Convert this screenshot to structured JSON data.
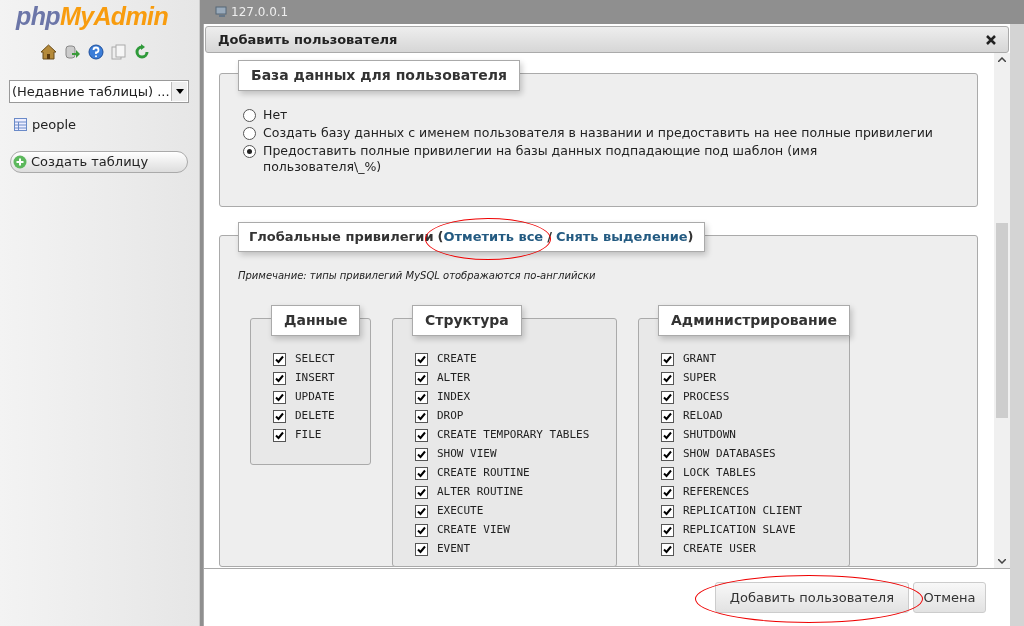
{
  "sidebar": {
    "logo": {
      "part1": "php",
      "part2": "MyAdmin"
    },
    "recent_tables": {
      "value": "(Недавние таблицы) ..."
    },
    "tables": [
      {
        "name": "people"
      }
    ],
    "create_table_button": "Создать таблицу"
  },
  "server_bar": {
    "host": "127.0.0.1"
  },
  "dialog": {
    "title": "Добавить пользователя",
    "database_section": {
      "legend": "База данных для пользователя",
      "options": [
        {
          "label": "Нет",
          "selected": false
        },
        {
          "label": "Создать базу данных с именем пользователя в названии и предоставить на нее полные привилегии",
          "selected": false
        },
        {
          "label": "Предоставить полные привилегии на базы данных подпадающие под шаблон (имя пользователя\\_%)",
          "selected": true
        }
      ]
    },
    "global_privileges": {
      "legend": "Глобальные привилегии",
      "open_paren": "(",
      "check_all": "Отметить все",
      "separator": "/",
      "uncheck_all": "Снять выделение",
      "close_paren": ")",
      "note": "Примечание: типы привилегий MySQL отображаются по-английски",
      "groups": [
        {
          "title": "Данные",
          "items": [
            {
              "label": "SELECT",
              "checked": true
            },
            {
              "label": "INSERT",
              "checked": true
            },
            {
              "label": "UPDATE",
              "checked": true
            },
            {
              "label": "DELETE",
              "checked": true
            },
            {
              "label": "FILE",
              "checked": true
            }
          ]
        },
        {
          "title": "Структура",
          "items": [
            {
              "label": "CREATE",
              "checked": true
            },
            {
              "label": "ALTER",
              "checked": true
            },
            {
              "label": "INDEX",
              "checked": true
            },
            {
              "label": "DROP",
              "checked": true
            },
            {
              "label": "CREATE TEMPORARY TABLES",
              "checked": true
            },
            {
              "label": "SHOW VIEW",
              "checked": true
            },
            {
              "label": "CREATE ROUTINE",
              "checked": true
            },
            {
              "label": "ALTER ROUTINE",
              "checked": true
            },
            {
              "label": "EXECUTE",
              "checked": true
            },
            {
              "label": "CREATE VIEW",
              "checked": true
            },
            {
              "label": "EVENT",
              "checked": true
            }
          ]
        },
        {
          "title": "Администрирование",
          "items": [
            {
              "label": "GRANT",
              "checked": true
            },
            {
              "label": "SUPER",
              "checked": true
            },
            {
              "label": "PROCESS",
              "checked": true
            },
            {
              "label": "RELOAD",
              "checked": true
            },
            {
              "label": "SHUTDOWN",
              "checked": true
            },
            {
              "label": "SHOW DATABASES",
              "checked": true
            },
            {
              "label": "LOCK TABLES",
              "checked": true
            },
            {
              "label": "REFERENCES",
              "checked": true
            },
            {
              "label": "REPLICATION CLIENT",
              "checked": true
            },
            {
              "label": "REPLICATION SLAVE",
              "checked": true
            },
            {
              "label": "CREATE USER",
              "checked": true
            }
          ]
        }
      ]
    },
    "buttons": {
      "submit": "Добавить пользователя",
      "cancel": "Отмена"
    }
  }
}
